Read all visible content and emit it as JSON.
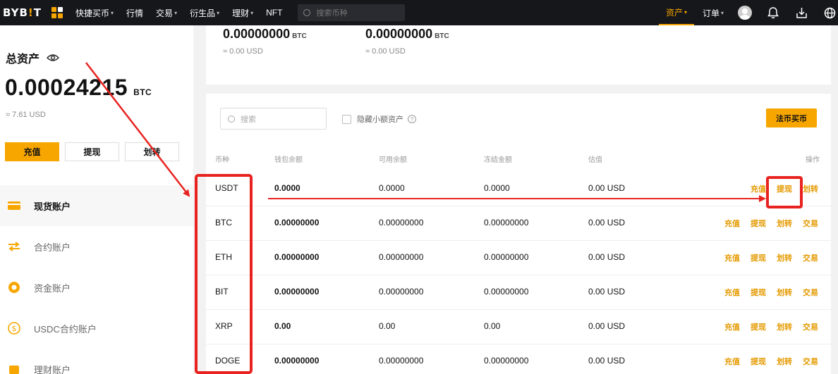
{
  "nav": {
    "logo_a": "BYB",
    "logo_dot": "!",
    "logo_b": "T",
    "items": [
      "快捷买币",
      "行情",
      "交易",
      "衍生品",
      "理财",
      "NFT"
    ],
    "search_placeholder": "搜索币种",
    "assets": "资产",
    "orders": "订单"
  },
  "sidebar": {
    "total_label": "总资产",
    "total_value": "0.00024215",
    "total_unit": "BTC",
    "total_usd": "≈ 7.61 USD",
    "deposit": "充值",
    "withdraw": "提现",
    "transfer": "划转",
    "menu": [
      "现货账户",
      "合约账户",
      "资金账户",
      "USDC合约账户",
      "理财账户"
    ]
  },
  "top_card": {
    "acct1_value": "0.00000000",
    "acct1_unit": "BTC",
    "acct1_usd": "≈ 0.00 USD",
    "acct2_value": "0.00000000",
    "acct2_unit": "BTC",
    "acct2_usd": "≈ 0.00 USD"
  },
  "table": {
    "search_placeholder": "搜索",
    "hide_small": "隐藏小额资产",
    "fiat_button": "法币买币",
    "headers": [
      "币种",
      "钱包余额",
      "可用余额",
      "冻结金额",
      "估值",
      "操作"
    ],
    "rows": [
      {
        "coin": "USDT",
        "wallet": "0.0000",
        "available": "0.0000",
        "frozen": "0.0000",
        "value": "0.00 USD"
      },
      {
        "coin": "BTC",
        "wallet": "0.00000000",
        "available": "0.00000000",
        "frozen": "0.00000000",
        "value": "0.00 USD"
      },
      {
        "coin": "ETH",
        "wallet": "0.00000000",
        "available": "0.00000000",
        "frozen": "0.00000000",
        "value": "0.00 USD"
      },
      {
        "coin": "BIT",
        "wallet": "0.00000000",
        "available": "0.00000000",
        "frozen": "0.00000000",
        "value": "0.00 USD"
      },
      {
        "coin": "XRP",
        "wallet": "0.00",
        "available": "0.00",
        "frozen": "0.00",
        "value": "0.00 USD"
      },
      {
        "coin": "DOGE",
        "wallet": "0.00000000",
        "available": "0.00000000",
        "frozen": "0.00000000",
        "value": "0.00 USD"
      }
    ],
    "ops": [
      "充值",
      "提现",
      "划转",
      "交易"
    ]
  },
  "colors": {
    "accent": "#f7a600",
    "nav_bg": "#16171b",
    "annotation": "#e8231f"
  }
}
